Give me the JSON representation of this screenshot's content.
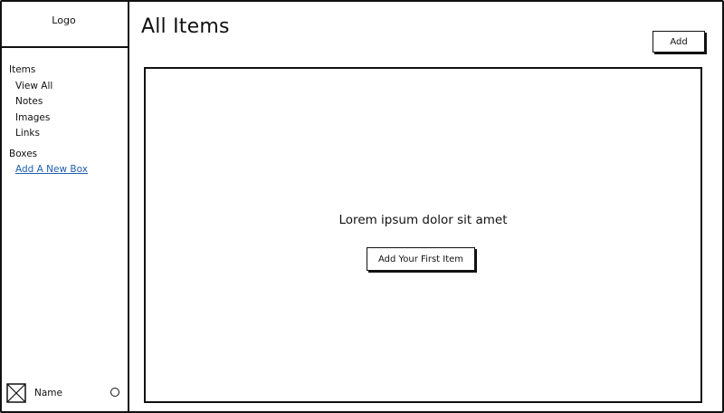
{
  "sidebar": {
    "logo": "Logo",
    "sections": [
      {
        "title": "Items",
        "items": [
          "View All",
          "Notes",
          "Images",
          "Links"
        ]
      },
      {
        "title": "Boxes",
        "link": "Add A New Box"
      }
    ],
    "user": {
      "name": "Name"
    }
  },
  "header": {
    "title": "All Items",
    "add_label": "Add"
  },
  "main": {
    "empty_message": "Lorem ipsum dolor sit amet",
    "first_item_label": "Add Your First Item"
  }
}
